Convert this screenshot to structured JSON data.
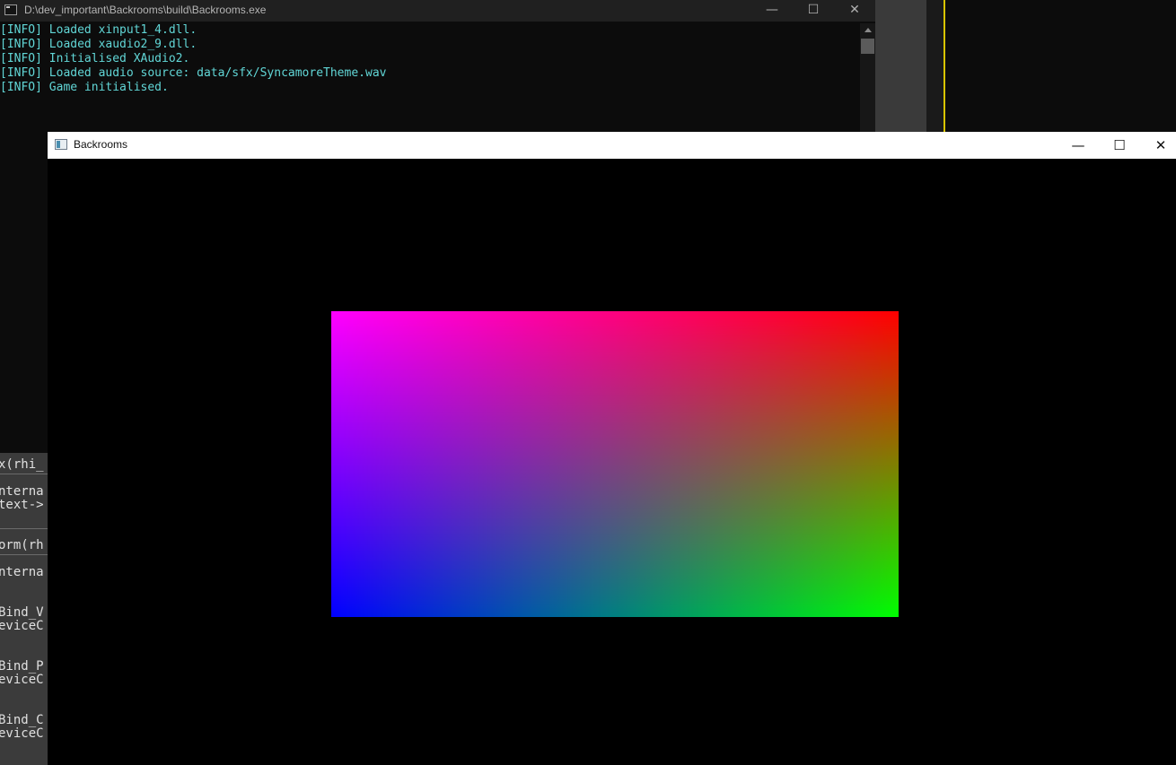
{
  "console": {
    "title": "D:\\dev_important\\Backrooms\\build\\Backrooms.exe",
    "minimize_glyph": "—",
    "maximize_glyph": "☐",
    "close_glyph": "✕",
    "log_lines": [
      "[INFO] Loaded xinput1_4.dll.",
      "[INFO] Loaded xaudio2_9.dll.",
      "[INFO] Initialised XAudio2.",
      "[INFO] Loaded audio source: data/sfx/SyncamoreTheme.wav",
      "[INFO] Game initialised."
    ],
    "text_color": "#61d6d6"
  },
  "editor": {
    "visible_fragments": [
      "x(rhi_",
      "nterna",
      "text->",
      "orm(rh",
      "nterna",
      "Bind_V",
      "eviceC",
      "Bind_P",
      "eviceC",
      "Bind_C",
      "eviceC"
    ]
  },
  "game": {
    "title": "Backrooms",
    "minimize_glyph": "—",
    "maximize_glyph": "☐",
    "close_glyph": "✕",
    "quad_corner_colors": {
      "top_left": "#ff00ff",
      "top_right": "#ff0000",
      "bottom_left": "#0000ff",
      "bottom_right": "#00ff00"
    }
  }
}
